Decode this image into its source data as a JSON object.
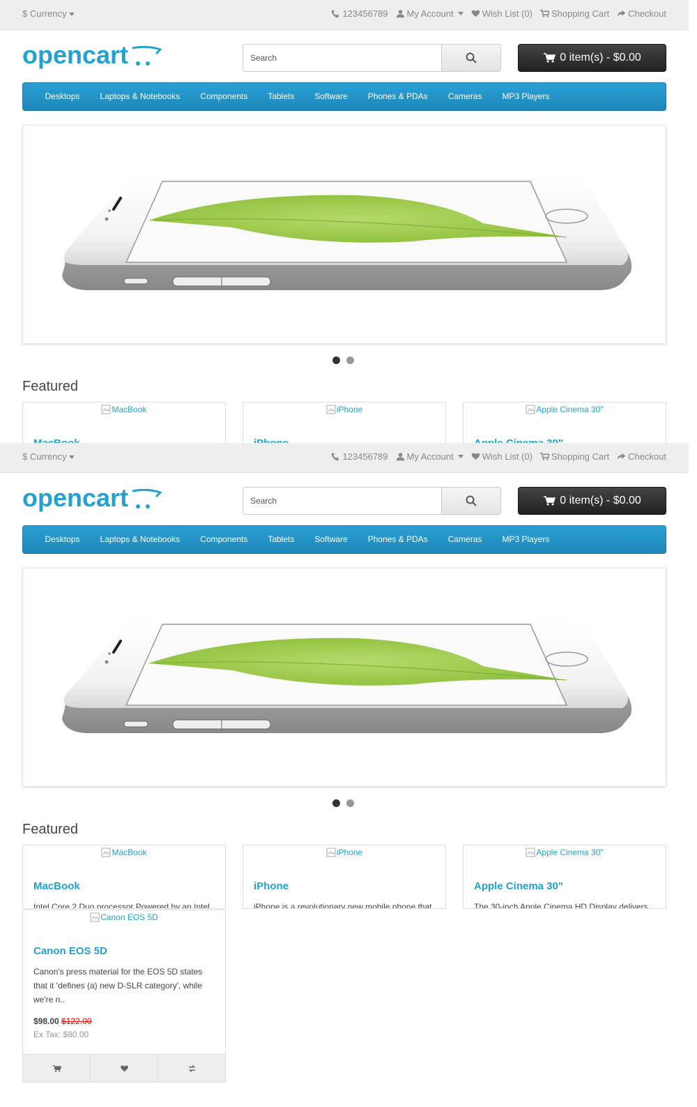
{
  "topbar": {
    "currency_label": "$ Currency",
    "phone": "123456789",
    "my_account": "My Account",
    "wish_list": "Wish List (0)",
    "shopping_cart": "Shopping Cart",
    "checkout": "Checkout"
  },
  "header": {
    "logo_text": "opencart",
    "search_placeholder": "Search",
    "cart_label": "0 item(s) - $0.00"
  },
  "menu": {
    "items": [
      "Desktops",
      "Laptops & Notebooks",
      "Components",
      "Tablets",
      "Software",
      "Phones & PDAs",
      "Cameras",
      "MP3 Players"
    ]
  },
  "slideshow": {
    "active_dot": 1,
    "dot_count": 2
  },
  "featured": {
    "title": "Featured",
    "products": [
      {
        "name": "MacBook",
        "image_alt": "MacBook",
        "description": "Intel Core 2 Duo processor Powered by an Intel"
      },
      {
        "name": "iPhone",
        "image_alt": "iPhone",
        "description": "iPhone is a revolutionary new mobile phone that"
      },
      {
        "name": "Apple Cinema 30\"",
        "image_alt": "Apple Cinema 30\"",
        "description": "The 30-inch Apple Cinema HD Display delivers"
      },
      {
        "name": "Canon EOS 5D",
        "image_alt": "Canon EOS 5D",
        "description": "Canon's press material for the EOS 5D states that it 'defines (a) new D-SLR category', while we're n..",
        "price": "$98.00",
        "old_price": "$122.00",
        "tax": "Ex Tax: $80.00"
      }
    ]
  },
  "colors": {
    "accent": "#23a1d1",
    "menu_bg": "#229ac8",
    "cart_bg": "#303030",
    "old_price": "#ff0000"
  },
  "icons": [
    "phone-icon",
    "user-icon",
    "heart-icon",
    "cart-icon",
    "share-icon",
    "search-icon",
    "compare-icon"
  ]
}
